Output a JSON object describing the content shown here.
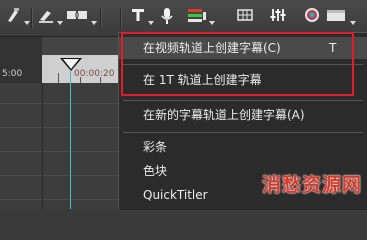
{
  "toolbar": {
    "icons": [
      "paint-icon",
      "pen-icon",
      "storyboard-icon",
      "title-icon",
      "microphone-icon",
      "track-color-icon",
      "grid-icon",
      "mixer-icon",
      "color-wheel-icon",
      "window-icon"
    ]
  },
  "ruler": {
    "left_label": "5:00",
    "right_label": "00:00:20"
  },
  "menu": {
    "items": [
      {
        "label": "在视频轨道上创建字幕(C)",
        "shortcut": "T",
        "highlighted": true
      },
      {
        "label": "在 1T 轨道上创建字幕",
        "shortcut": ""
      },
      {
        "label": "在新的字幕轨道上创建字幕(A)",
        "shortcut": ""
      },
      {
        "label": "彩条",
        "shortcut": ""
      },
      {
        "label": "色块",
        "shortcut": ""
      },
      {
        "label": "QuickTitler",
        "shortcut": ""
      }
    ]
  },
  "colors": {
    "highlight_box": "#e01e2a",
    "playhead": "#37c7c7"
  },
  "watermark": {
    "text": "消愁资源网"
  }
}
